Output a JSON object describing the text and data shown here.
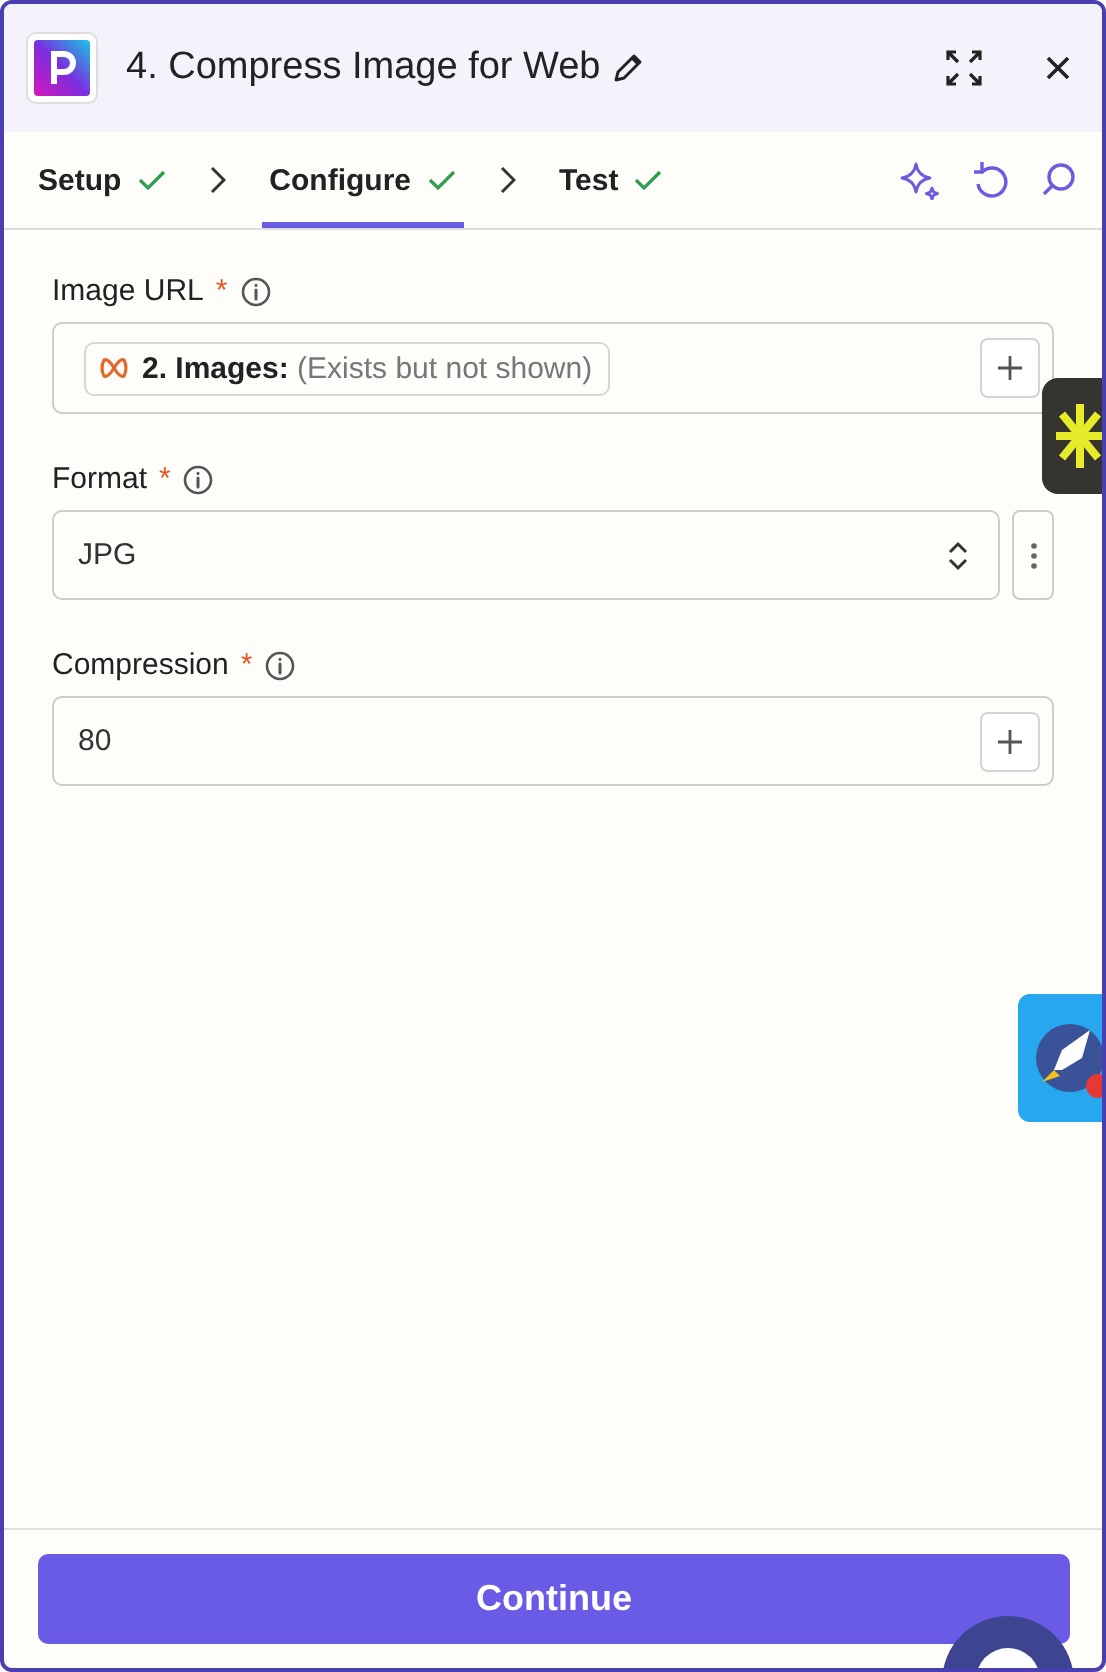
{
  "header": {
    "title": "4. Compress Image for Web"
  },
  "steps": [
    {
      "label": "Setup",
      "selected": false,
      "done": true
    },
    {
      "label": "Configure",
      "selected": true,
      "done": true
    },
    {
      "label": "Test",
      "selected": false,
      "done": true
    }
  ],
  "fields": [
    {
      "kind": "mapped",
      "label": "Image URL",
      "required_mark": "*",
      "pill": "**2. Images:** (Exists but not shown)"
    },
    {
      "kind": "select",
      "label": "Format",
      "required_mark": "*",
      "value": "JPG"
    },
    {
      "kind": "text",
      "label": "Compression",
      "required_mark": "*",
      "value": "80"
    }
  ],
  "footer": {
    "button": "Continue"
  }
}
